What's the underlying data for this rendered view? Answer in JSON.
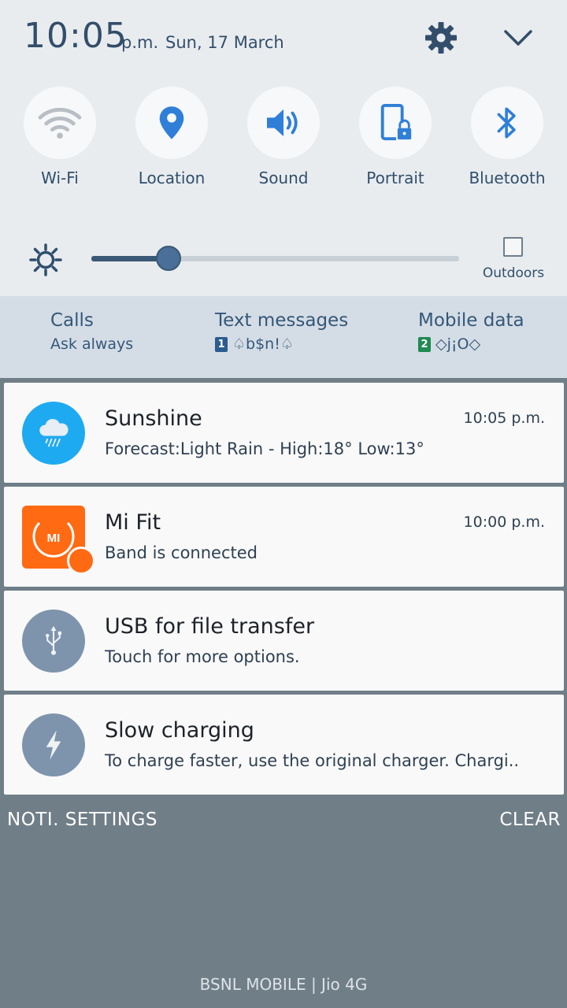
{
  "status": {
    "time": "10:05",
    "ampm": "p.m.",
    "date": "Sun, 17 March"
  },
  "quick_toggles": [
    {
      "label": "Wi-Fi",
      "icon": "wifi-icon",
      "active": false
    },
    {
      "label": "Location",
      "icon": "location-icon",
      "active": true
    },
    {
      "label": "Sound",
      "icon": "sound-icon",
      "active": true
    },
    {
      "label": "Portrait",
      "icon": "portrait-lock-icon",
      "active": true
    },
    {
      "label": "Bluetooth",
      "icon": "bluetooth-icon",
      "active": true
    }
  ],
  "brightness": {
    "level": 0.21,
    "outdoors_label": "Outdoors",
    "outdoors_checked": false
  },
  "sim": {
    "calls_label": "Calls",
    "calls_value": "Ask always",
    "text_label": "Text messages",
    "text_sim": "1",
    "text_value": "♤b$n!♤",
    "data_label": "Mobile data",
    "data_sim": "2",
    "data_value": "◇j¡O◇"
  },
  "notifications": [
    {
      "title": "Sunshine",
      "body": "Forecast:Light Rain - High:18° Low:13°",
      "time": "10:05 p.m.",
      "icon": "cloud-rain-icon"
    },
    {
      "title": "Mi Fit",
      "body": "Band is connected",
      "time": "10:00 p.m.",
      "icon": "mi-fit-icon"
    },
    {
      "title": "USB for file transfer",
      "body": "Touch for more options.",
      "time": "",
      "icon": "usb-icon"
    },
    {
      "title": "Slow charging",
      "body": "To charge faster, use the original charger. Chargi..",
      "time": "",
      "icon": "lightning-icon"
    }
  ],
  "footer": {
    "settings_label": "NOTI. SETTINGS",
    "clear_label": "CLEAR",
    "carrier": "BSNL MOBILE | Jio 4G"
  },
  "colors": {
    "accent": "#2f7fd8",
    "panel_bg": "#e9ecef",
    "backdrop": "#707e88",
    "sunshine_bg": "#1eaaf1",
    "mifit_bg": "#ff6a13",
    "system_icon_bg": "#7e94ad"
  }
}
